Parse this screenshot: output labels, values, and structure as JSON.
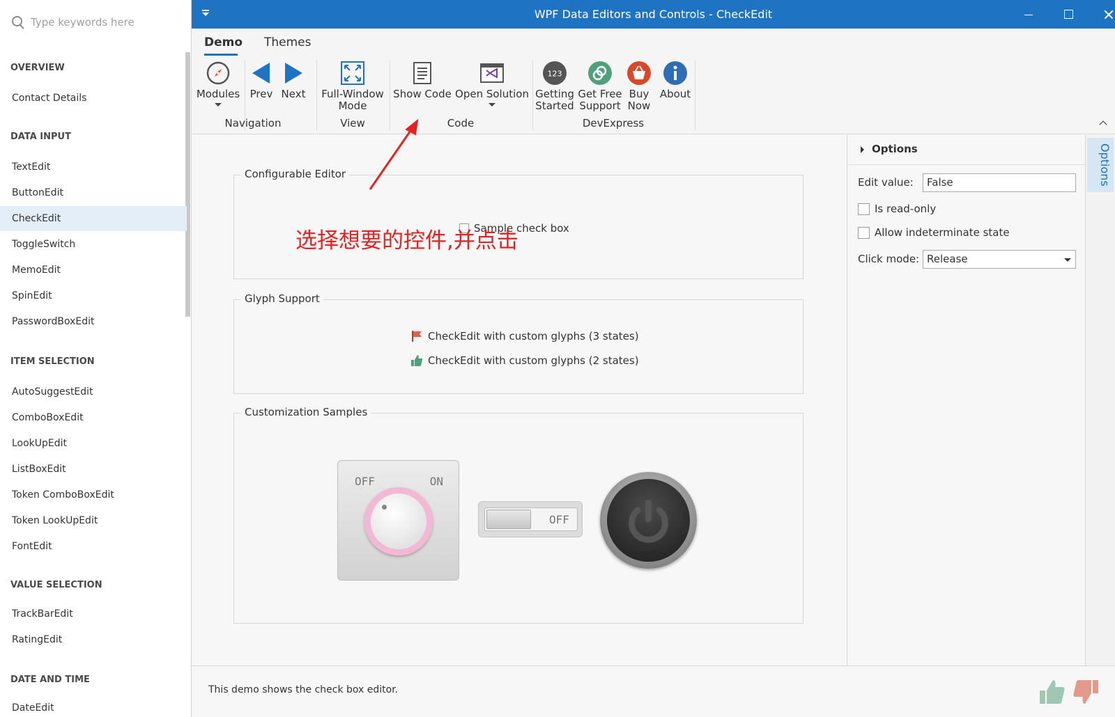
{
  "sidebar": {
    "search_placeholder": "Type keywords here",
    "groups": {
      "overview": "OVERVIEW",
      "data_input": "DATA INPUT",
      "item_selection": "ITEM SELECTION",
      "value_selection": "VALUE SELECTION",
      "date_and_time": "DATE AND TIME"
    },
    "items": {
      "contact_details": "Contact Details",
      "textedit": "TextEdit",
      "buttonedit": "ButtonEdit",
      "checkedit": "CheckEdit",
      "toggleswitch": "ToggleSwitch",
      "memoedit": "MemoEdit",
      "spinedit": "SpinEdit",
      "passwordboxedit": "PasswordBoxEdit",
      "autosuggestedit": "AutoSuggestEdit",
      "comboboxedit": "ComboBoxEdit",
      "lookupedit": "LookUpEdit",
      "listboxedit": "ListBoxEdit",
      "token_comboboxedit": "Token ComboBoxEdit",
      "token_lookupedit": "Token LookUpEdit",
      "fontedit": "FontEdit",
      "trackbaredit": "TrackBarEdit",
      "ratingedit": "RatingEdit",
      "dateedit": "DateEdit"
    },
    "selected_item": "CheckEdit"
  },
  "window": {
    "title": "WPF Data Editors and Controls - CheckEdit"
  },
  "ribbon": {
    "tabs": {
      "demo": "Demo",
      "themes": "Themes"
    },
    "buttons": {
      "modules": "Modules",
      "prev": "Prev",
      "next": "Next",
      "full_window_l1": "Full-Window",
      "full_window_l2": "Mode",
      "show_code": "Show Code",
      "open_solution": "Open Solution",
      "getting_started_l1": "Getting",
      "getting_started_l2": "Started",
      "get_free_support_l1": "Get Free",
      "get_free_support_l2": "Support",
      "buy_now_l1": "Buy",
      "buy_now_l2": "Now",
      "about": "About",
      "getting_started_badge": "123"
    },
    "groups": {
      "navigation": "Navigation",
      "view": "View",
      "code": "Code",
      "devexpress": "DevExpress"
    }
  },
  "demo": {
    "configurable_editor": {
      "title": "Configurable Editor",
      "checkbox_label": "Sample check box"
    },
    "glyph_support": {
      "title": "Glyph Support",
      "item1": "CheckEdit with custom glyphs (3 states)",
      "item2": "CheckEdit with custom glyphs (2 states)"
    },
    "customization_samples": {
      "title": "Customization Samples",
      "knob_off": "OFF",
      "knob_on": "ON",
      "switch_state": "OFF"
    }
  },
  "options": {
    "title": "Options",
    "edit_value_label": "Edit value:",
    "edit_value": "False",
    "is_readonly": "Is read-only",
    "allow_indeterminate": "Allow indeterminate state",
    "click_mode_label": "Click mode:",
    "click_mode_value": "Release",
    "side_tab": "Options"
  },
  "status": {
    "text": "This demo shows the check box editor."
  },
  "annotation": {
    "text": "选择想要的控件,并点击"
  },
  "colors": {
    "accent": "#1e73c2",
    "annotation": "#e52222",
    "selected_item_bg": "#e3eef9"
  }
}
